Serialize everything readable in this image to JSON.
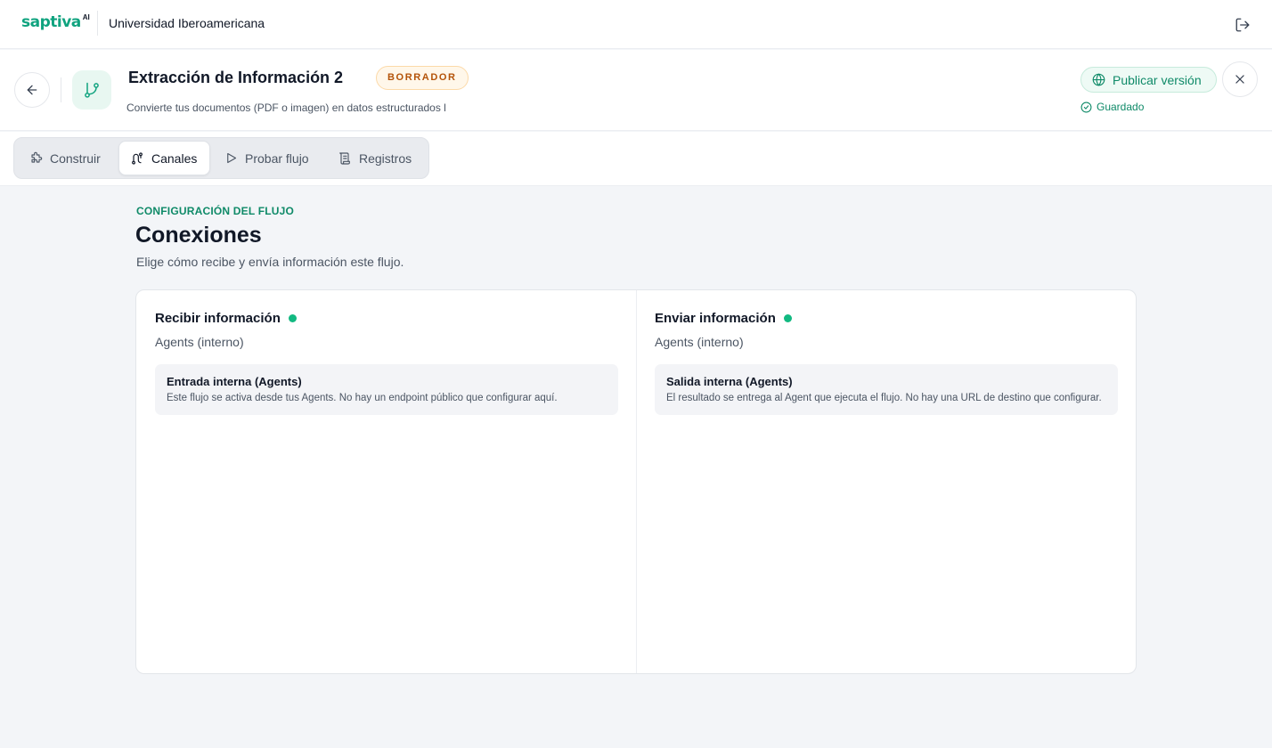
{
  "topbar": {
    "logo": "saptiva",
    "logo_suffix": "AI",
    "org_name": "Universidad Iberoamericana",
    "logout_icon": "logout-icon"
  },
  "header": {
    "title": "Extracción de Información 2",
    "badge": "BORRADOR",
    "description": "Convierte tus documentos (PDF o imagen) en datos estructurados l",
    "publish_label": "Publicar versión",
    "saved_label": "Guardado"
  },
  "tabs": [
    {
      "label": "Construir",
      "icon": "puzzle-icon",
      "active": false
    },
    {
      "label": "Canales",
      "icon": "route-icon",
      "active": true
    },
    {
      "label": "Probar flujo",
      "icon": "play-icon",
      "active": false
    },
    {
      "label": "Registros",
      "icon": "scroll-icon",
      "active": false
    }
  ],
  "main": {
    "eyebrow": "CONFIGURACIÓN DEL FLUJO",
    "title": "Conexiones",
    "subtitle": "Elige cómo recibe y envía información este flujo."
  },
  "receive": {
    "title": "Recibir información",
    "mode": "Agents (interno)",
    "box_title": "Entrada interna (Agents)",
    "box_text": "Este flujo se activa desde tus Agents. No hay un endpoint público que configurar aquí."
  },
  "send": {
    "title": "Enviar información",
    "mode": "Agents (interno)",
    "box_title": "Salida interna (Agents)",
    "box_text": "El resultado se entrega al Agent que ejecuta el flujo. No hay una URL de destino que configurar."
  },
  "colors": {
    "accent": "#10a37f",
    "status_dot": "#12b981",
    "badge_text": "#b45309"
  }
}
